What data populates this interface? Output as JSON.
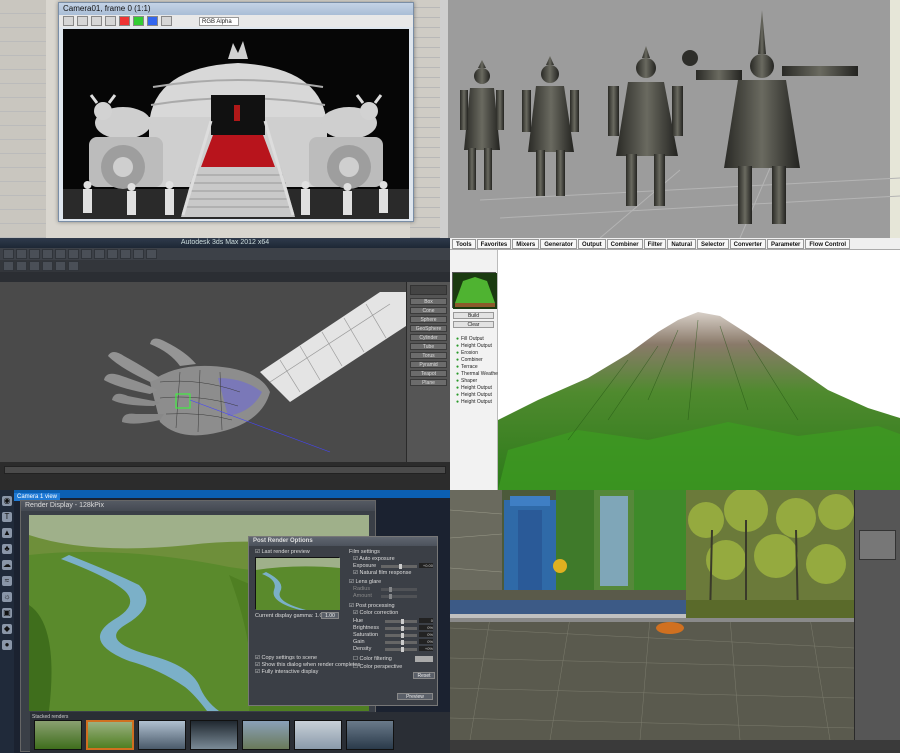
{
  "panels": {
    "yurt_render": {
      "window_title": "Camera01, frame 0 (1:1)",
      "viewport_selector": "RGB Alpha"
    },
    "hand_modeling": {
      "window_title": "Autodesk 3ds Max 2012 x64",
      "command_buttons": [
        "Box",
        "Cone",
        "Sphere",
        "GeoSphere",
        "Cylinder",
        "Tube",
        "Torus",
        "Pyramid",
        "Teapot",
        "Plane"
      ]
    },
    "terrain": {
      "tabs": [
        "Tools",
        "Favorites",
        "Mixers",
        "Generator",
        "Output",
        "Combiner",
        "Filter",
        "Natural",
        "Selector",
        "Converter",
        "Parameter",
        "Flow Control"
      ],
      "side_buttons": [
        "Build",
        "Clear"
      ],
      "nodes": [
        "Fill Output",
        "Height Output",
        "Erosion",
        "Combiner",
        "Terrace",
        "Thermal Weathering",
        "Shaper",
        "Height Output",
        "Height Output",
        "Height Output"
      ]
    },
    "render_display": {
      "tab_label": "Camera 1 view",
      "window_title": "Render Display - 128kPix",
      "thumbs_label": "Stacked renders",
      "dialog": {
        "title": "Post Render Options",
        "last_render_preview": "Last render preview",
        "current_display_gamma": "Current display gamma: 1.00",
        "gamma_value": "1.00",
        "film_settings": "Film settings",
        "auto_exposure": "Auto exposure",
        "exposure": "Exposure",
        "exposure_value": "+0.00",
        "natural_film_response": "Natural film response",
        "lens_glare": "Lens glare",
        "radius": "Radius",
        "amount": "Amount",
        "post_processing": "Post processing",
        "color_correction": "Color correction",
        "rows": [
          {
            "label": "Hue",
            "value": "0"
          },
          {
            "label": "Brightness",
            "value": "0%"
          },
          {
            "label": "Saturation",
            "value": "0%"
          },
          {
            "label": "Gain",
            "value": "0%"
          },
          {
            "label": "Density",
            "value": "+0%"
          }
        ],
        "color_filtering": "Color filtering",
        "color_perspective": "Color perspective",
        "reset": "Reset",
        "copy_settings": "Copy settings to scene",
        "show_dialog": "Show this dialog when render completes",
        "fully_interactive": "Fully interactive display",
        "preview": "Preview"
      }
    }
  },
  "colors": {
    "grass": "#3e8a2a",
    "carpet": "#b8141c",
    "ocean_blue": "#2b66c4",
    "jungle_green": "#6fa32a"
  }
}
